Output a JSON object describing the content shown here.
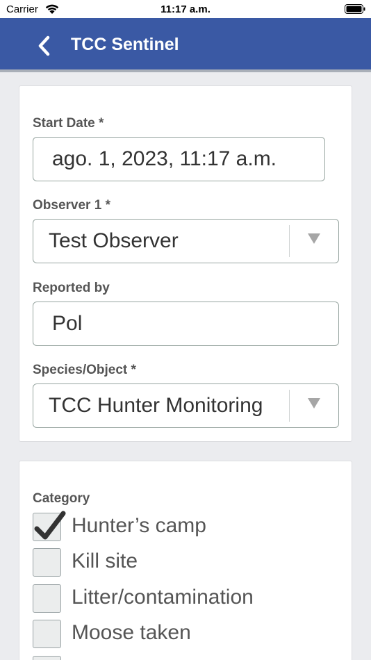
{
  "status_bar": {
    "carrier": "Carrier",
    "time": "11:17 a.m."
  },
  "header": {
    "title": "TCC Sentinel",
    "back_icon": "chevron-left-icon",
    "background_color": "#3a59a4"
  },
  "form": {
    "start_date": {
      "label": "Start Date *",
      "value": "ago. 1, 2023, 11:17 a.m."
    },
    "observer": {
      "label": "Observer 1 *",
      "value": "Test Observer"
    },
    "reported_by": {
      "label": "Reported by",
      "value": "Pol"
    },
    "species": {
      "label": "Species/Object *",
      "value": "TCC Hunter Monitoring"
    }
  },
  "category": {
    "label": "Category",
    "options": [
      {
        "label": "Hunter’s camp",
        "checked": true
      },
      {
        "label": "Kill site",
        "checked": false
      },
      {
        "label": "Litter/contamination",
        "checked": false
      },
      {
        "label": "Moose taken",
        "checked": false
      }
    ]
  }
}
